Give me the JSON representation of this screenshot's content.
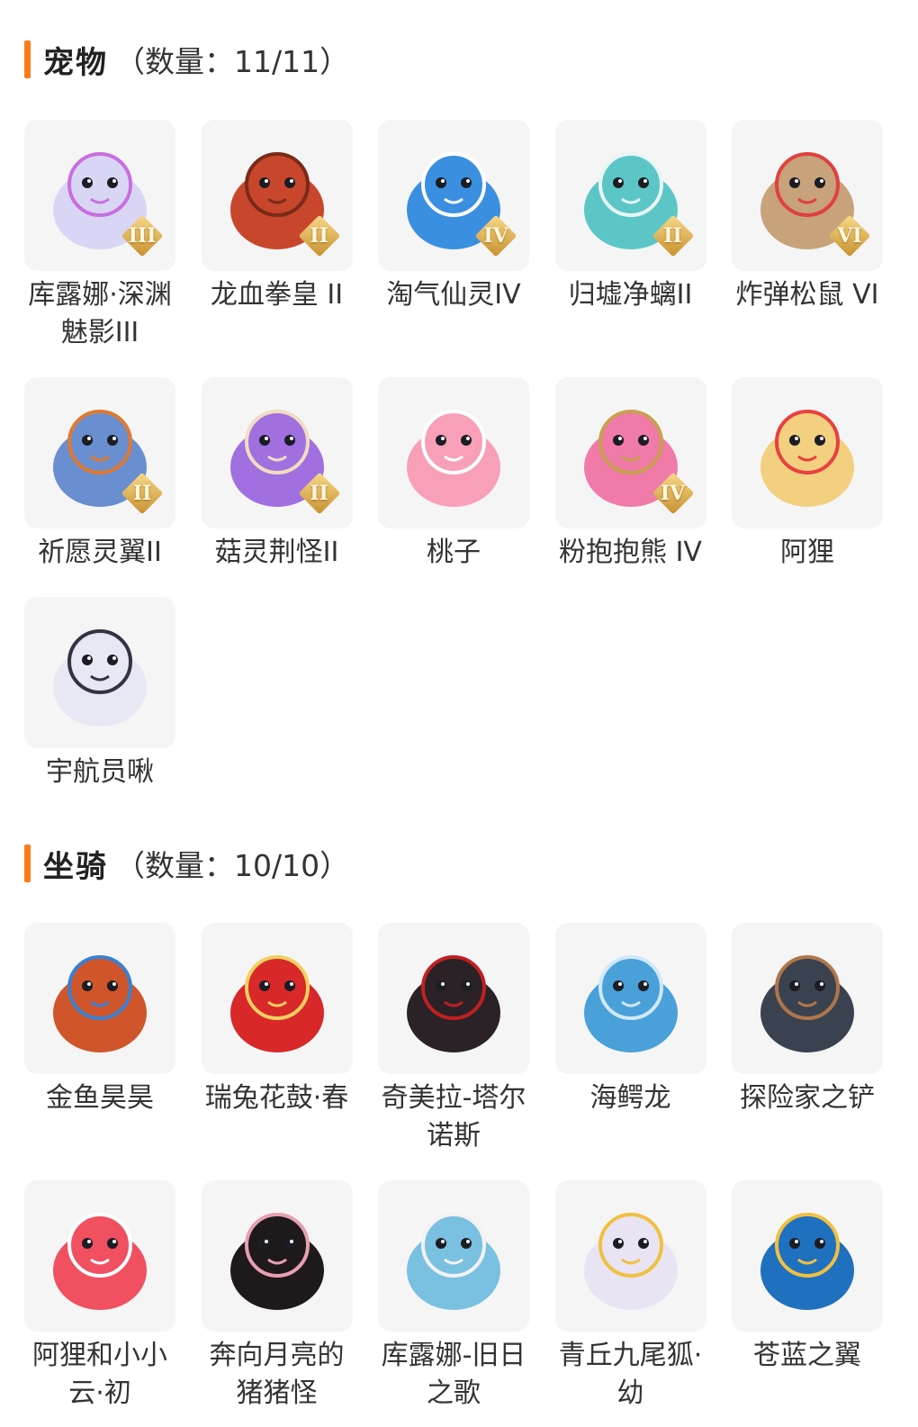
{
  "pets": {
    "title": "宠物",
    "count": "（数量：11/11）",
    "items": [
      {
        "label": "库露娜·深渊魅影III",
        "grade": "III",
        "icon": "white-spirit-pet-icon",
        "color": "#d9d6f5",
        "accent": "#c86fe0"
      },
      {
        "label": "龙血拳皇 II",
        "grade": "II",
        "icon": "red-ram-beast-icon",
        "color": "#c8472c",
        "accent": "#7a2a18"
      },
      {
        "label": "淘气仙灵IV",
        "grade": "IV",
        "icon": "blue-puppy-icon",
        "color": "#3a8fe0",
        "accent": "#ffffff"
      },
      {
        "label": "归墟净螭II",
        "grade": "II",
        "icon": "teal-dragon-icon",
        "color": "#5cc6c6",
        "accent": "#e8f5f5"
      },
      {
        "label": "炸弹松鼠 VI",
        "grade": "VI",
        "icon": "squirrel-icon",
        "color": "#c7a27a",
        "accent": "#e04040"
      },
      {
        "label": "祈愿灵翼II",
        "grade": "II",
        "icon": "griffin-bird-icon",
        "color": "#6a8fd0",
        "accent": "#e07a30"
      },
      {
        "label": "菇灵荆怪II",
        "grade": "II",
        "icon": "purple-elf-icon",
        "color": "#a070e0",
        "accent": "#f2dcc0"
      },
      {
        "label": "桃子",
        "grade": "",
        "icon": "pink-fox-icon",
        "color": "#f7a0b8",
        "accent": "#ffffff"
      },
      {
        "label": "粉抱抱熊 IV",
        "grade": "IV",
        "icon": "pink-bear-icon",
        "color": "#f07aa8",
        "accent": "#c8a050"
      },
      {
        "label": "阿狸",
        "grade": "",
        "icon": "lion-hat-fox-icon",
        "color": "#f2d080",
        "accent": "#e84040"
      },
      {
        "label": "宇航员啾",
        "grade": "",
        "icon": "astronaut-bird-icon",
        "color": "#e8e8f4",
        "accent": "#333344"
      }
    ]
  },
  "mounts": {
    "title": "坐骑",
    "count": "（数量：10/10）",
    "items": [
      {
        "label": "金鱼昊昊",
        "grade": "",
        "icon": "goldfish-icon",
        "color": "#d0552a",
        "accent": "#3a80d0"
      },
      {
        "label": "瑞兔花鼓·春",
        "grade": "",
        "icon": "rabbit-drum-icon",
        "color": "#d8282a",
        "accent": "#f0d060"
      },
      {
        "label": "奇美拉-塔尔诺斯",
        "grade": "",
        "icon": "black-chimera-icon",
        "color": "#2a2226",
        "accent": "#c02020"
      },
      {
        "label": "海鳄龙",
        "grade": "",
        "icon": "ice-dragon-icon",
        "color": "#4aa0d8",
        "accent": "#cfe8f8"
      },
      {
        "label": "探险家之铲",
        "grade": "",
        "icon": "shovel-icon",
        "color": "#3a4250",
        "accent": "#b0764a"
      },
      {
        "label": "阿狸和小小云·初",
        "grade": "",
        "icon": "fox-on-cloud-icon",
        "color": "#f05060",
        "accent": "#ffffff"
      },
      {
        "label": "奔向月亮的猪猪怪",
        "grade": "",
        "icon": "black-pig-icon",
        "color": "#1e1a1c",
        "accent": "#e8a0b0"
      },
      {
        "label": "库露娜-旧日之歌",
        "grade": "",
        "icon": "sheep-girl-icon",
        "color": "#7ac0e0",
        "accent": "#f2f2f2"
      },
      {
        "label": "青丘九尾狐·幼",
        "grade": "",
        "icon": "white-fox-icon",
        "color": "#e8e4f4",
        "accent": "#f0c040"
      },
      {
        "label": "苍蓝之翼",
        "grade": "",
        "icon": "blue-dragon-icon",
        "color": "#2070c0",
        "accent": "#f0c040"
      }
    ]
  },
  "accent_color": "#ff7a1a"
}
